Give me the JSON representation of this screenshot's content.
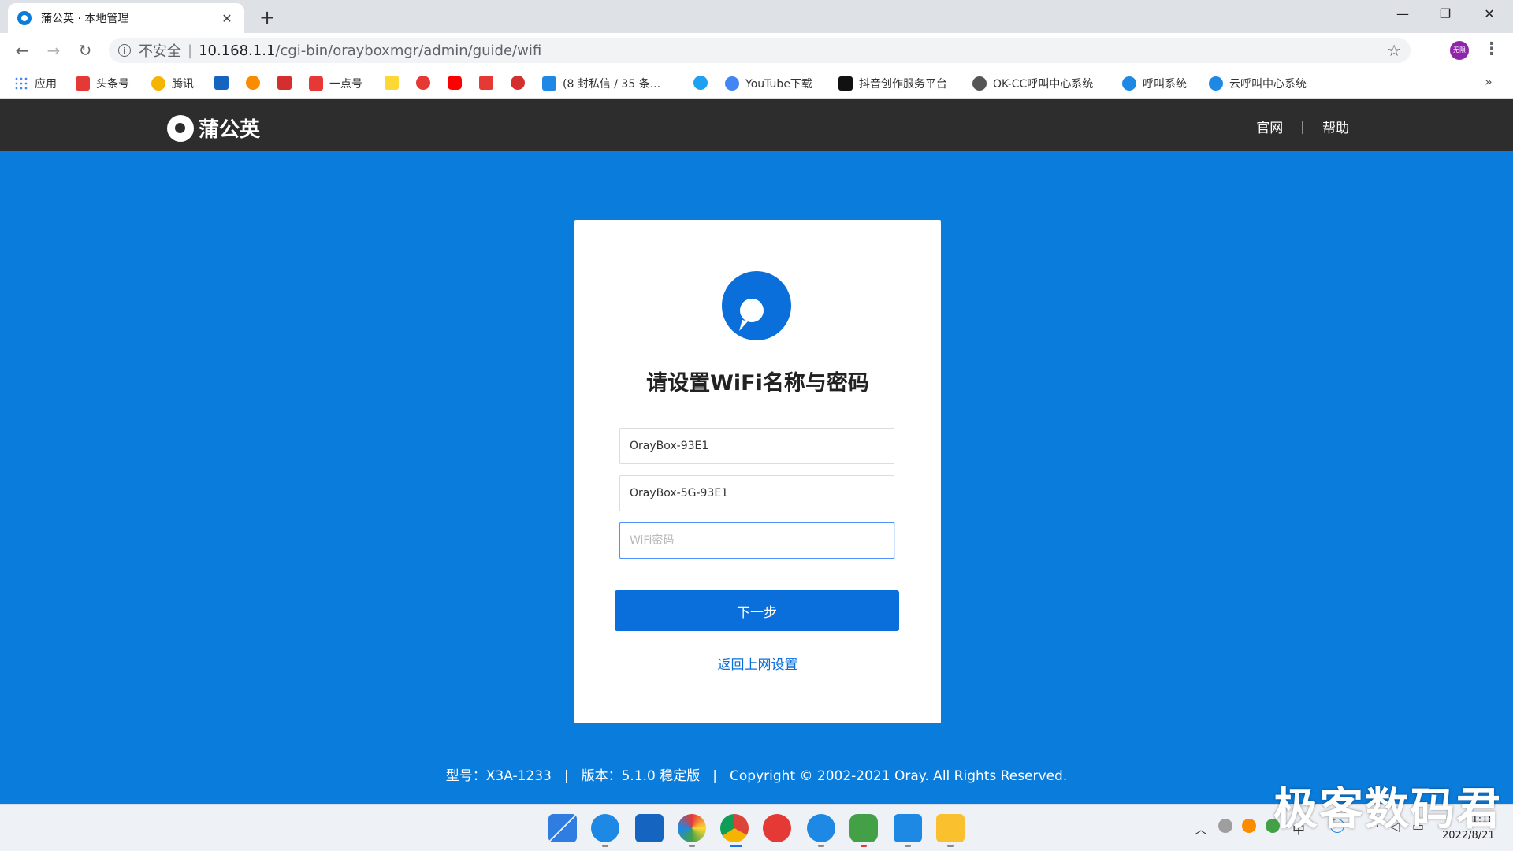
{
  "browser": {
    "tab_title": "蒲公英 · 本地管理",
    "tab_close": "✕",
    "new_tab": "+",
    "window_controls": {
      "minimize": "—",
      "restore": "❐",
      "close": "✕"
    },
    "nav": {
      "back": "←",
      "forward": "→",
      "reload": "↻"
    },
    "address": {
      "security_label": "不安全",
      "host": "10.168.1.1",
      "path": "/cgi-bin/orayboxmgr/admin/guide/wifi"
    },
    "profile_label": "无限",
    "bookmarks": [
      {
        "label": "应用",
        "color": "#e53935"
      },
      {
        "label": "头条号",
        "color": "#e53935"
      },
      {
        "label": "腾讯",
        "color": "#f4b400"
      },
      {
        "label": "",
        "color": "#1565c0"
      },
      {
        "label": "",
        "color": "#fb8c00"
      },
      {
        "label": "",
        "color": "#d32f2f"
      },
      {
        "label": "一点号",
        "color": "#e53935"
      },
      {
        "label": "",
        "color": "#fdd835"
      },
      {
        "label": "",
        "color": "#e53935"
      },
      {
        "label": "",
        "color": "#ff0000"
      },
      {
        "label": "",
        "color": "#e53935"
      },
      {
        "label": "",
        "color": "#d32f2f"
      },
      {
        "label": "(8 封私信 / 35 条...",
        "color": "#1e88e5"
      },
      {
        "label": "",
        "color": "#1da1f2"
      },
      {
        "label": "YouTube下载",
        "color": "#4285f4"
      },
      {
        "label": "抖音创作服务平台",
        "color": "#111111"
      },
      {
        "label": "OK-CC呼叫中心系统",
        "color": "#555555"
      },
      {
        "label": "呼叫系统",
        "color": "#1e88e5"
      },
      {
        "label": "云呼叫中心系统",
        "color": "#1e88e5"
      }
    ],
    "bookmarks_more": "»"
  },
  "appbar": {
    "brand": "蒲公英",
    "links": [
      "官网",
      "帮助"
    ],
    "divider": "|"
  },
  "card": {
    "heading": "请设置WiFi名称与密码",
    "ssid_24": "OrayBox-93E1",
    "ssid_5g": "OrayBox-5G-93E1",
    "password_placeholder": "WiFi密码",
    "next_button": "下一步",
    "back_link": "返回上网设置"
  },
  "footer": {
    "model": "型号：X3A-1233",
    "version": "版本：5.1.0 稳定版",
    "copyright": "Copyright © 2002-2021 Oray. All Rights Reserved.",
    "divider": "|"
  },
  "taskbar": {
    "clock_time": "1:18",
    "clock_date": "2022/8/21"
  },
  "watermark": "极客数码君",
  "colors": {
    "page_bg": "#0a7cdc",
    "header_bg": "#2d2d2d",
    "primary": "#0a6fdb"
  }
}
